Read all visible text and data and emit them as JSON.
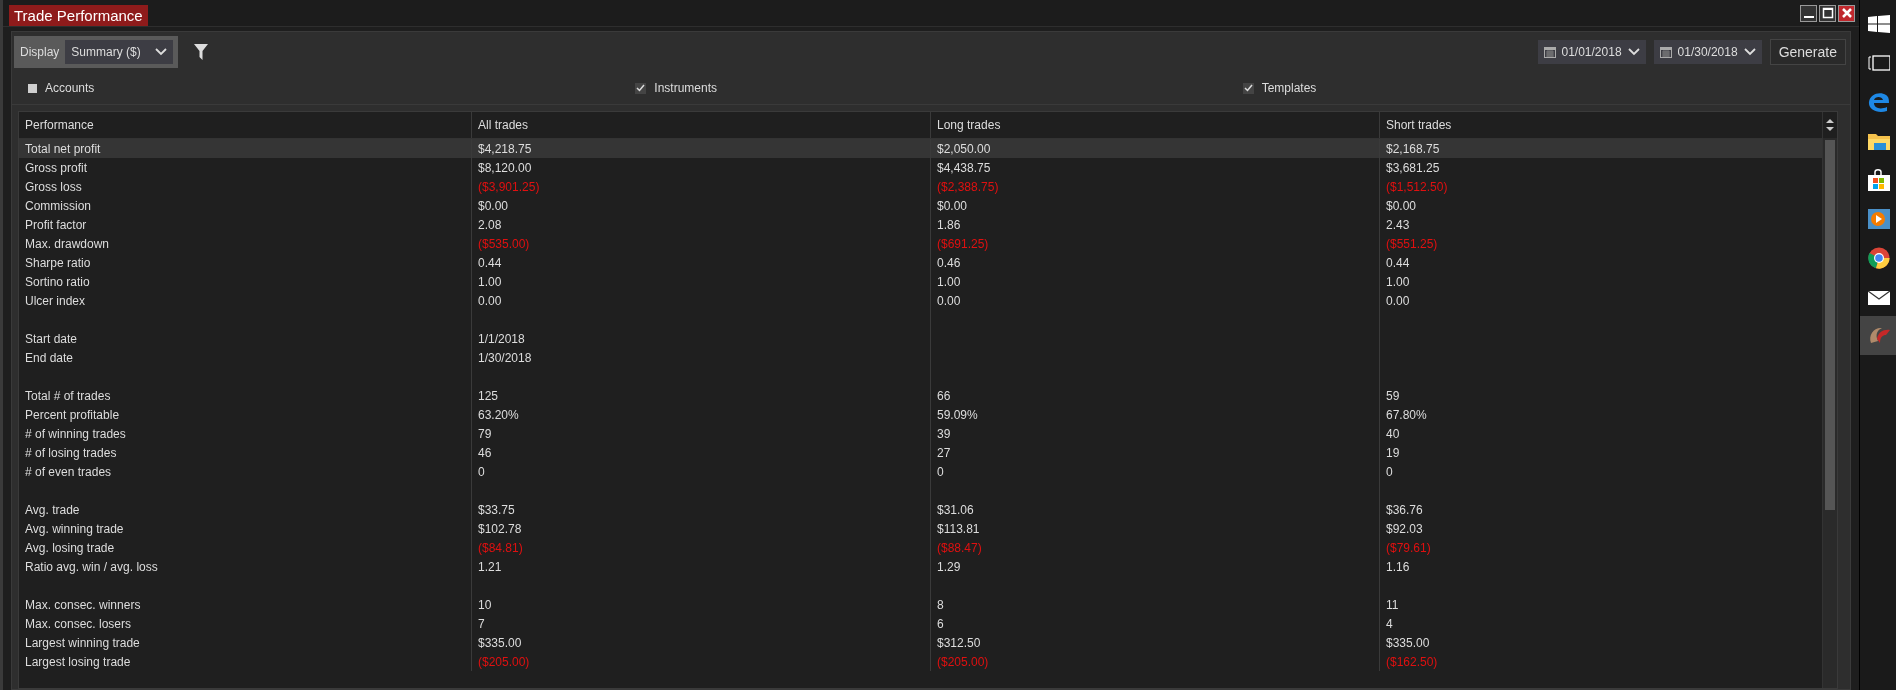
{
  "window": {
    "title": "Trade Performance"
  },
  "toolbar": {
    "display_label": "Display",
    "display_value": "Summary ($)",
    "start_date": "01/01/2018",
    "end_date": "01/30/2018",
    "generate": "Generate"
  },
  "filters": [
    {
      "label": "Accounts",
      "checked": false
    },
    {
      "label": "Instruments",
      "checked": true
    },
    {
      "label": "Templates",
      "checked": true
    }
  ],
  "table": {
    "columns": [
      "Performance",
      "All trades",
      "Long trades",
      "Short trades"
    ],
    "rows": [
      {
        "kind": "data",
        "selected": true,
        "cells": [
          {
            "text": "Total net profit",
            "negative": false
          },
          {
            "text": "$4,218.75",
            "negative": false
          },
          {
            "text": "$2,050.00",
            "negative": false
          },
          {
            "text": "$2,168.75",
            "negative": false
          }
        ]
      },
      {
        "kind": "data",
        "selected": false,
        "cells": [
          {
            "text": "Gross profit",
            "negative": false
          },
          {
            "text": "$8,120.00",
            "negative": false
          },
          {
            "text": "$4,438.75",
            "negative": false
          },
          {
            "text": "$3,681.25",
            "negative": false
          }
        ]
      },
      {
        "kind": "data",
        "selected": false,
        "cells": [
          {
            "text": "Gross loss",
            "negative": false
          },
          {
            "text": "($3,901.25)",
            "negative": true
          },
          {
            "text": "($2,388.75)",
            "negative": true
          },
          {
            "text": "($1,512.50)",
            "negative": true
          }
        ]
      },
      {
        "kind": "data",
        "selected": false,
        "cells": [
          {
            "text": "Commission",
            "negative": false
          },
          {
            "text": "$0.00",
            "negative": false
          },
          {
            "text": "$0.00",
            "negative": false
          },
          {
            "text": "$0.00",
            "negative": false
          }
        ]
      },
      {
        "kind": "data",
        "selected": false,
        "cells": [
          {
            "text": "Profit factor",
            "negative": false
          },
          {
            "text": "2.08",
            "negative": false
          },
          {
            "text": "1.86",
            "negative": false
          },
          {
            "text": "2.43",
            "negative": false
          }
        ]
      },
      {
        "kind": "data",
        "selected": false,
        "cells": [
          {
            "text": "Max. drawdown",
            "negative": false
          },
          {
            "text": "($535.00)",
            "negative": true
          },
          {
            "text": "($691.25)",
            "negative": true
          },
          {
            "text": "($551.25)",
            "negative": true
          }
        ]
      },
      {
        "kind": "data",
        "selected": false,
        "cells": [
          {
            "text": "Sharpe ratio",
            "negative": false
          },
          {
            "text": "0.44",
            "negative": false
          },
          {
            "text": "0.46",
            "negative": false
          },
          {
            "text": "0.44",
            "negative": false
          }
        ]
      },
      {
        "kind": "data",
        "selected": false,
        "cells": [
          {
            "text": "Sortino ratio",
            "negative": false
          },
          {
            "text": "1.00",
            "negative": false
          },
          {
            "text": "1.00",
            "negative": false
          },
          {
            "text": "1.00",
            "negative": false
          }
        ]
      },
      {
        "kind": "data",
        "selected": false,
        "cells": [
          {
            "text": "Ulcer index",
            "negative": false
          },
          {
            "text": "0.00",
            "negative": false
          },
          {
            "text": "0.00",
            "negative": false
          },
          {
            "text": "0.00",
            "negative": false
          }
        ]
      },
      {
        "kind": "gap",
        "selected": false
      },
      {
        "kind": "data",
        "selected": false,
        "cells": [
          {
            "text": "Start date",
            "negative": false
          },
          {
            "text": "1/1/2018",
            "negative": false
          }
        ]
      },
      {
        "kind": "data",
        "selected": false,
        "cells": [
          {
            "text": "End date",
            "negative": false
          },
          {
            "text": "1/30/2018",
            "negative": false
          }
        ]
      },
      {
        "kind": "gap",
        "selected": false
      },
      {
        "kind": "data",
        "selected": false,
        "cells": [
          {
            "text": "Total # of trades",
            "negative": false
          },
          {
            "text": "125",
            "negative": false
          },
          {
            "text": "66",
            "negative": false
          },
          {
            "text": "59",
            "negative": false
          }
        ]
      },
      {
        "kind": "data",
        "selected": false,
        "cells": [
          {
            "text": "Percent profitable",
            "negative": false
          },
          {
            "text": "63.20%",
            "negative": false
          },
          {
            "text": "59.09%",
            "negative": false
          },
          {
            "text": "67.80%",
            "negative": false
          }
        ]
      },
      {
        "kind": "data",
        "selected": false,
        "cells": [
          {
            "text": "# of winning trades",
            "negative": false
          },
          {
            "text": "79",
            "negative": false
          },
          {
            "text": "39",
            "negative": false
          },
          {
            "text": "40",
            "negative": false
          }
        ]
      },
      {
        "kind": "data",
        "selected": false,
        "cells": [
          {
            "text": "# of losing trades",
            "negative": false
          },
          {
            "text": "46",
            "negative": false
          },
          {
            "text": "27",
            "negative": false
          },
          {
            "text": "19",
            "negative": false
          }
        ]
      },
      {
        "kind": "data",
        "selected": false,
        "cells": [
          {
            "text": "# of even trades",
            "negative": false
          },
          {
            "text": "0",
            "negative": false
          },
          {
            "text": "0",
            "negative": false
          },
          {
            "text": "0",
            "negative": false
          }
        ]
      },
      {
        "kind": "gap",
        "selected": false
      },
      {
        "kind": "data",
        "selected": false,
        "cells": [
          {
            "text": "Avg. trade",
            "negative": false
          },
          {
            "text": "$33.75",
            "negative": false
          },
          {
            "text": "$31.06",
            "negative": false
          },
          {
            "text": "$36.76",
            "negative": false
          }
        ]
      },
      {
        "kind": "data",
        "selected": false,
        "cells": [
          {
            "text": "Avg. winning trade",
            "negative": false
          },
          {
            "text": "$102.78",
            "negative": false
          },
          {
            "text": "$113.81",
            "negative": false
          },
          {
            "text": "$92.03",
            "negative": false
          }
        ]
      },
      {
        "kind": "data",
        "selected": false,
        "cells": [
          {
            "text": "Avg. losing trade",
            "negative": false
          },
          {
            "text": "($84.81)",
            "negative": true
          },
          {
            "text": "($88.47)",
            "negative": true
          },
          {
            "text": "($79.61)",
            "negative": true
          }
        ]
      },
      {
        "kind": "data",
        "selected": false,
        "cells": [
          {
            "text": "Ratio avg. win / avg. loss",
            "negative": false
          },
          {
            "text": "1.21",
            "negative": false
          },
          {
            "text": "1.29",
            "negative": false
          },
          {
            "text": "1.16",
            "negative": false
          }
        ]
      },
      {
        "kind": "gap",
        "selected": false
      },
      {
        "kind": "data",
        "selected": false,
        "cells": [
          {
            "text": "Max. consec. winners",
            "negative": false
          },
          {
            "text": "10",
            "negative": false
          },
          {
            "text": "8",
            "negative": false
          },
          {
            "text": "11",
            "negative": false
          }
        ]
      },
      {
        "kind": "data",
        "selected": false,
        "cells": [
          {
            "text": "Max. consec. losers",
            "negative": false
          },
          {
            "text": "7",
            "negative": false
          },
          {
            "text": "6",
            "negative": false
          },
          {
            "text": "4",
            "negative": false
          }
        ]
      },
      {
        "kind": "data",
        "selected": false,
        "cells": [
          {
            "text": "Largest winning trade",
            "negative": false
          },
          {
            "text": "$335.00",
            "negative": false
          },
          {
            "text": "$312.50",
            "negative": false
          },
          {
            "text": "$335.00",
            "negative": false
          }
        ]
      },
      {
        "kind": "data",
        "selected": false,
        "cells": [
          {
            "text": "Largest losing trade",
            "negative": false
          },
          {
            "text": "($205.00)",
            "negative": true
          },
          {
            "text": "($205.00)",
            "negative": true
          },
          {
            "text": "($162.50)",
            "negative": true
          }
        ]
      }
    ]
  },
  "taskbar": {
    "items": [
      {
        "kind": "start",
        "selected": false
      },
      {
        "kind": "taskview",
        "selected": false
      },
      {
        "kind": "browser",
        "selected": false
      },
      {
        "kind": "folder",
        "selected": false
      },
      {
        "kind": "store",
        "selected": false
      },
      {
        "kind": "player",
        "selected": false
      },
      {
        "kind": "globe",
        "selected": false
      },
      {
        "kind": "mail",
        "selected": false
      },
      {
        "kind": "app",
        "selected": true
      }
    ]
  }
}
